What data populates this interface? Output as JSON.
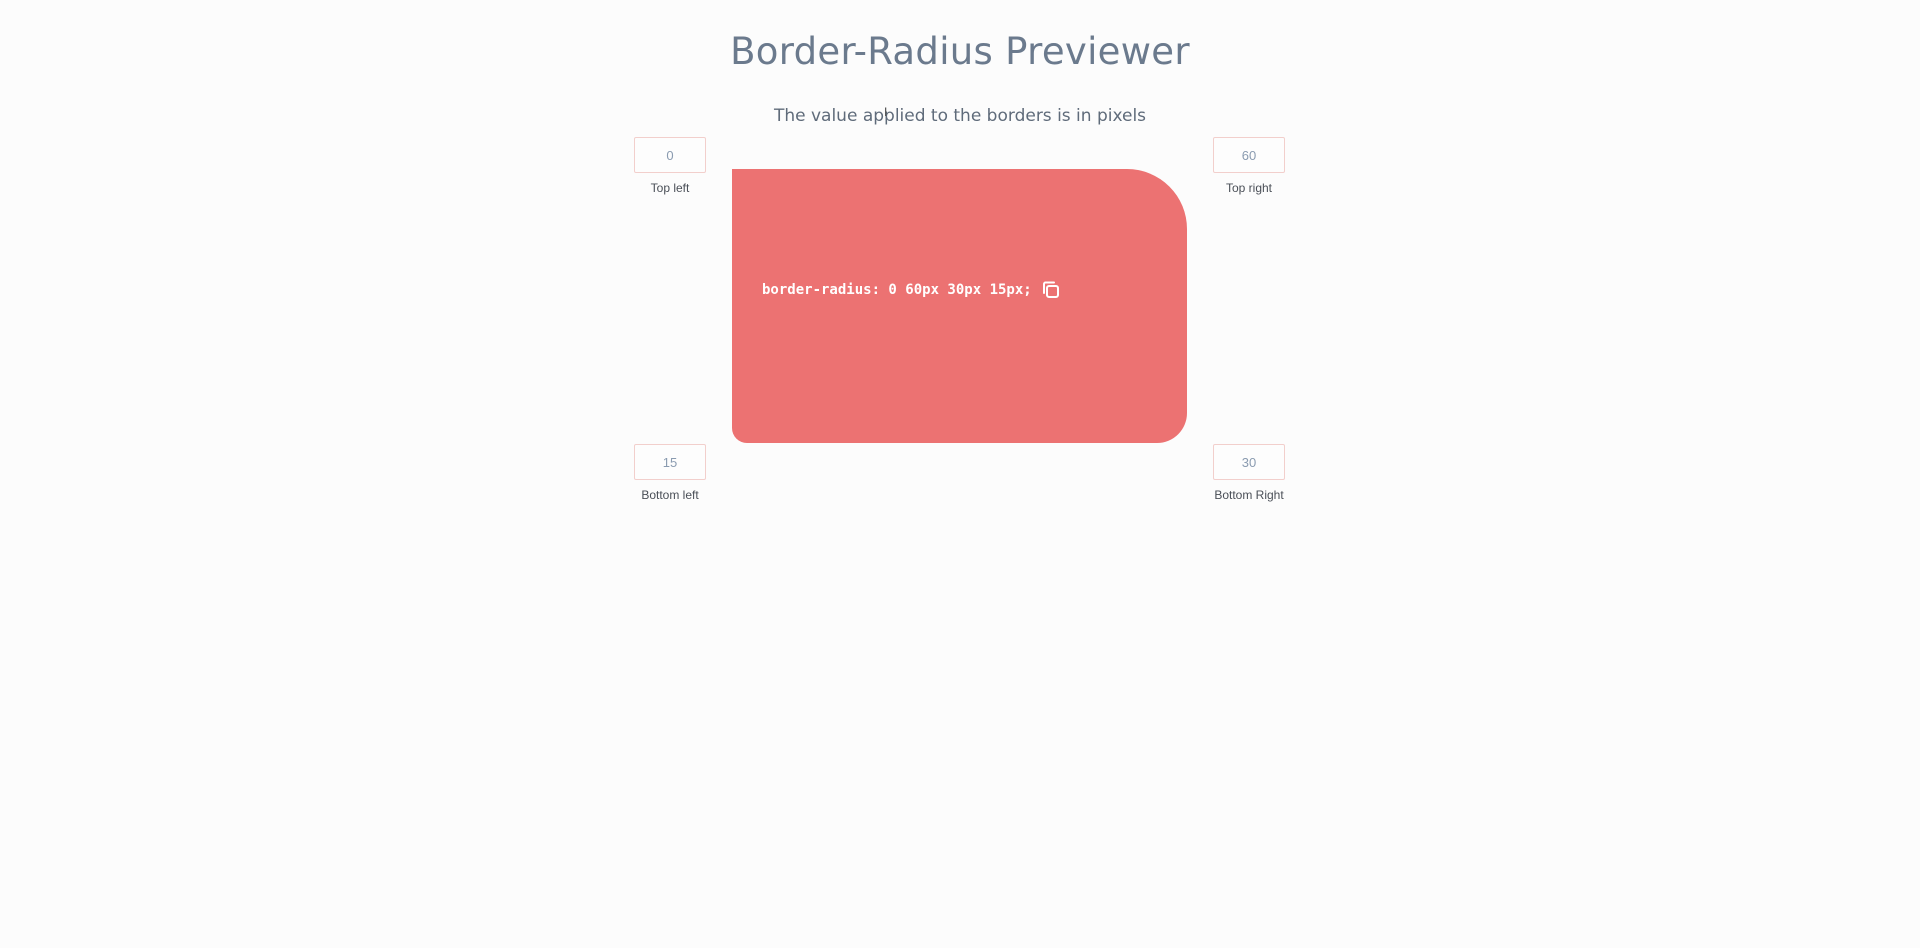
{
  "header": {
    "title": "Border-Radius Previewer",
    "subtitle": "The value applied to the borders is in pixels"
  },
  "corners": {
    "top_left": {
      "value": "0",
      "label": "Top left"
    },
    "top_right": {
      "value": "60",
      "label": "Top right"
    },
    "bottom_left": {
      "value": "15",
      "label": "Bottom left"
    },
    "bottom_right": {
      "value": "30",
      "label": "Bottom Right"
    }
  },
  "preview": {
    "css_output": "border-radius: 0 60px 30px 15px;",
    "copy_icon": "copy-icon",
    "color": "#ec7272"
  }
}
